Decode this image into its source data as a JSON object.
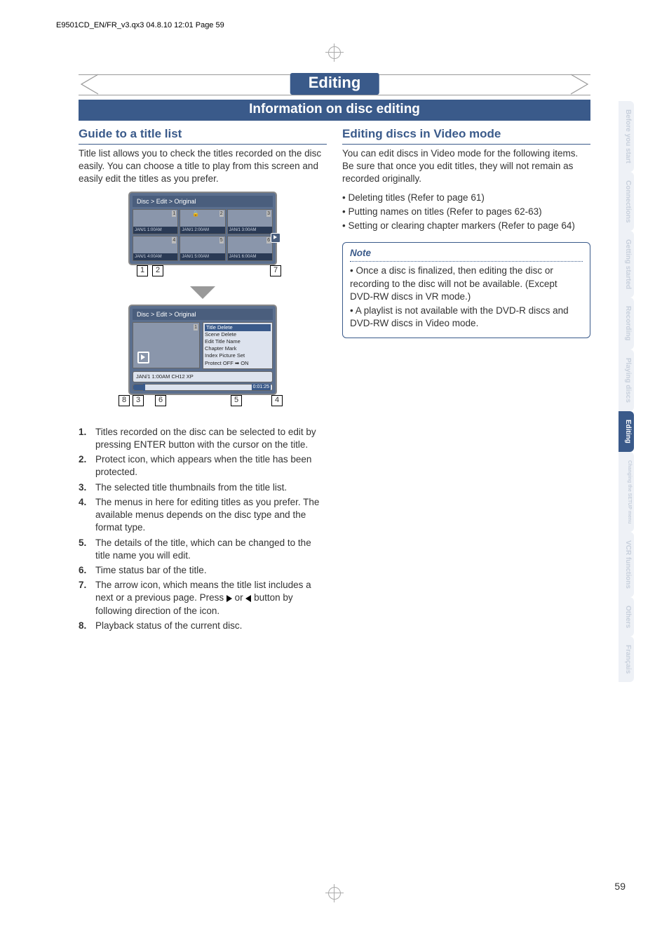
{
  "header_line": "E9501CD_EN/FR_v3.qx3  04.8.10  12:01  Page 59",
  "chapter_title": "Editing",
  "section_title": "Information on disc editing",
  "left": {
    "heading": "Guide to a title list",
    "intro": "Title list allows you to check the titles recorded on the disc easily. You can choose a title to play from this screen and easily edit the titles as you prefer.",
    "osd_breadcrumb": "Disc > Edit > Original",
    "thumbs": [
      {
        "n": "1",
        "ts": "JAN/1   1:00AM"
      },
      {
        "n": "2",
        "ts": "JAN/1   2:00AM"
      },
      {
        "n": "3",
        "ts": "JAN/1   3:00AM"
      },
      {
        "n": "4",
        "ts": "JAN/1   4:00AM"
      },
      {
        "n": "5",
        "ts": "JAN/1   5:00AM"
      },
      {
        "n": "6",
        "ts": "JAN/1   6:00AM"
      }
    ],
    "osd2_menu": [
      "Title Delete",
      "Scene Delete",
      "Edit Title Name",
      "Chapter Mark",
      "Index Picture Set",
      "Protect OFF ➡ ON"
    ],
    "osd2_info": "JAN/1  1:00AM  CH12    XP",
    "osd2_time": "0:01:25",
    "callouts_top": {
      "1": "1",
      "2": "2",
      "7": "7"
    },
    "callouts_bot": {
      "8": "8",
      "3": "3",
      "6": "6",
      "5": "5",
      "4": "4"
    },
    "list": [
      {
        "n": "1.",
        "t": "Titles recorded on the disc can be selected to edit by pressing ENTER button with the cursor on the title."
      },
      {
        "n": "2.",
        "t": "Protect icon, which appears when the title has been protected."
      },
      {
        "n": "3.",
        "t": "The selected title thumbnails from the title list."
      },
      {
        "n": "4.",
        "t": "The menus in here for editing titles as you prefer. The available menus depends on the disc type and the format type."
      },
      {
        "n": "5.",
        "t": "The details of the title, which can be changed to the title name you will edit."
      },
      {
        "n": "6.",
        "t": "Time status bar of the title."
      },
      {
        "n": "7.",
        "t": "The arrow icon, which means the title list includes a next or a previous page. Press ▶ or ◀ button by following direction of the icon."
      },
      {
        "n": "8.",
        "t": "Playback status of the current disc."
      }
    ],
    "list7_prefix": "The arrow icon, which means the title list includes a next or a previous page. Press ",
    "list7_mid": " or ",
    "list7_suffix": " button by following direction of the icon."
  },
  "right": {
    "heading": "Editing discs in Video mode",
    "intro": "You can edit discs in Video mode for the following items. Be sure that once you edit titles, they will not remain as recorded originally.",
    "bullets": [
      "• Deleting titles (Refer to page 61)",
      "• Putting names on titles (Refer to pages 62-63)",
      "• Setting or clearing chapter markers (Refer to page 64)"
    ],
    "note_title": "Note",
    "note_items": [
      "• Once a disc is finalized, then editing the disc or recording to the disc will not be available. (Except DVD-RW discs in VR mode.)",
      "• A playlist is not available with the DVD-R discs and DVD-RW discs in Video mode."
    ]
  },
  "tabs": [
    "Before you start",
    "Connections",
    "Getting started",
    "Recording",
    "Playing discs",
    "Editing",
    "Changing the SETUP menu",
    "VCR functions",
    "Others",
    "Français"
  ],
  "active_tab": "Editing",
  "page_number": "59"
}
